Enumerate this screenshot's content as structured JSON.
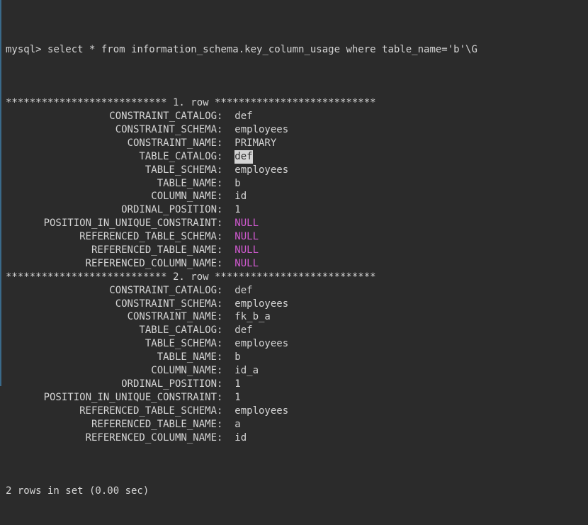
{
  "prompt": "mysql>",
  "query": "select * from information_schema.key_column_usage where table_name='b'\\G",
  "row_stars_left": "***************************",
  "row_stars_right": "***************************",
  "row_word": "row",
  "rows": [
    {
      "n": "1.",
      "fields": [
        {
          "k": "CONSTRAINT_CATALOG",
          "v": "def",
          "null": false,
          "hl": false
        },
        {
          "k": "CONSTRAINT_SCHEMA",
          "v": "employees",
          "null": false,
          "hl": false
        },
        {
          "k": "CONSTRAINT_NAME",
          "v": "PRIMARY",
          "null": false,
          "hl": false
        },
        {
          "k": "TABLE_CATALOG",
          "v": "def",
          "null": false,
          "hl": true
        },
        {
          "k": "TABLE_SCHEMA",
          "v": "employees",
          "null": false,
          "hl": false
        },
        {
          "k": "TABLE_NAME",
          "v": "b",
          "null": false,
          "hl": false
        },
        {
          "k": "COLUMN_NAME",
          "v": "id",
          "null": false,
          "hl": false
        },
        {
          "k": "ORDINAL_POSITION",
          "v": "1",
          "null": false,
          "hl": false
        },
        {
          "k": "POSITION_IN_UNIQUE_CONSTRAINT",
          "v": "NULL",
          "null": true,
          "hl": false
        },
        {
          "k": "REFERENCED_TABLE_SCHEMA",
          "v": "NULL",
          "null": true,
          "hl": false
        },
        {
          "k": "REFERENCED_TABLE_NAME",
          "v": "NULL",
          "null": true,
          "hl": false
        },
        {
          "k": "REFERENCED_COLUMN_NAME",
          "v": "NULL",
          "null": true,
          "hl": false
        }
      ]
    },
    {
      "n": "2.",
      "fields": [
        {
          "k": "CONSTRAINT_CATALOG",
          "v": "def",
          "null": false,
          "hl": false
        },
        {
          "k": "CONSTRAINT_SCHEMA",
          "v": "employees",
          "null": false,
          "hl": false
        },
        {
          "k": "CONSTRAINT_NAME",
          "v": "fk_b_a",
          "null": false,
          "hl": false
        },
        {
          "k": "TABLE_CATALOG",
          "v": "def",
          "null": false,
          "hl": false
        },
        {
          "k": "TABLE_SCHEMA",
          "v": "employees",
          "null": false,
          "hl": false
        },
        {
          "k": "TABLE_NAME",
          "v": "b",
          "null": false,
          "hl": false
        },
        {
          "k": "COLUMN_NAME",
          "v": "id_a",
          "null": false,
          "hl": false
        },
        {
          "k": "ORDINAL_POSITION",
          "v": "1",
          "null": false,
          "hl": false
        },
        {
          "k": "POSITION_IN_UNIQUE_CONSTRAINT",
          "v": "1",
          "null": false,
          "hl": false
        },
        {
          "k": "REFERENCED_TABLE_SCHEMA",
          "v": "employees",
          "null": false,
          "hl": false
        },
        {
          "k": "REFERENCED_TABLE_NAME",
          "v": "a",
          "null": false,
          "hl": false
        },
        {
          "k": "REFERENCED_COLUMN_NAME",
          "v": "id",
          "null": false,
          "hl": false
        }
      ]
    }
  ],
  "status": "2 rows in set (0.00 sec)"
}
